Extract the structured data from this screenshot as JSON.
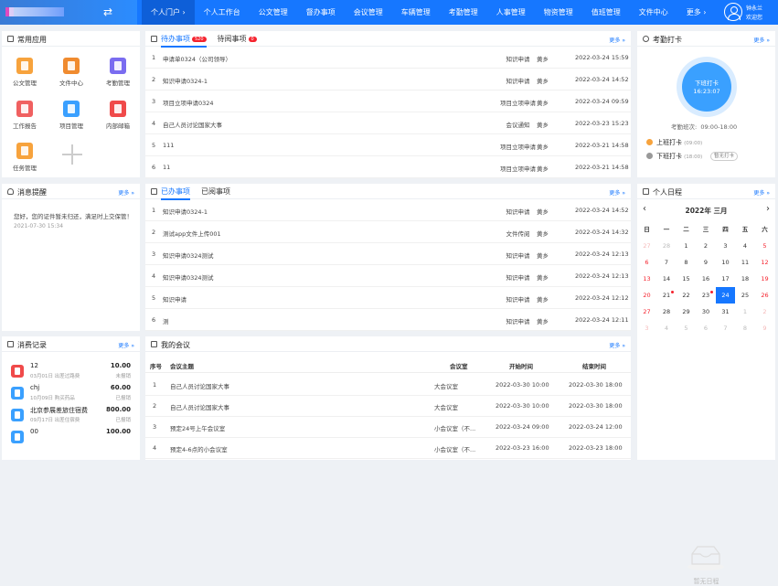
{
  "header": {
    "nav": [
      "个人门户 ›",
      "个人工作台",
      "公文管理",
      "督办事项",
      "会议管理",
      "车辆管理",
      "考勤管理",
      "人事管理",
      "物资管理",
      "值班管理",
      "文件中心",
      "更多 ›"
    ],
    "user_name": "钟永兰",
    "user_sub": "欢迎您"
  },
  "common_apps": {
    "title": "常用应用",
    "items": [
      {
        "label": "公文管理",
        "color": "#f7a33d"
      },
      {
        "label": "文件中心",
        "color": "#f08b2f"
      },
      {
        "label": "考勤管理",
        "color": "#7a6cf0"
      },
      {
        "label": "工作报告",
        "color": "#f06060"
      },
      {
        "label": "项目管理",
        "color": "#3aa0ff"
      },
      {
        "label": "内部邮箱",
        "color": "#f04a4a"
      },
      {
        "label": "任务管理",
        "color": "#f7a33d"
      }
    ]
  },
  "todo": {
    "tab1": "待办事项",
    "tab1_badge": "520",
    "tab2": "待阅事项",
    "tab2_badge": "0",
    "more": "更多",
    "rows": [
      {
        "no": "1",
        "title": "申请单0324（公司领导）",
        "type": "知识申请",
        "user": "黄乡",
        "time": "2022-03-24 15:59"
      },
      {
        "no": "2",
        "title": "知识申请0324-1",
        "type": "知识申请",
        "user": "黄乡",
        "time": "2022-03-24 14:52"
      },
      {
        "no": "3",
        "title": "项目立项申请0324",
        "type": "项目立项申请",
        "user": "黄乡",
        "time": "2022-03-24 09:59"
      },
      {
        "no": "4",
        "title": "自己人员讨论国家大事",
        "type": "会议通知",
        "user": "黄乡",
        "time": "2022-03-23 15:23"
      },
      {
        "no": "5",
        "title": "111",
        "type": "项目立项申请",
        "user": "黄乡",
        "time": "2022-03-21 14:58"
      },
      {
        "no": "6",
        "title": "11",
        "type": "项目立项申请",
        "user": "黄乡",
        "time": "2022-03-21 14:58"
      }
    ]
  },
  "attendance": {
    "title": "考勤打卡",
    "more": "更多",
    "clock_label": "下班打卡",
    "clock_time": "16:23:07",
    "shift_label": "考勤班次:",
    "shift": "09:00-18:00",
    "on_label": "上班打卡",
    "on_time": "(09:00)",
    "off_label": "下班打卡",
    "off_time": "(18:00)",
    "off_chip": "暂无打卡"
  },
  "notice": {
    "title": "消息提醒",
    "more": "更多",
    "text": "您好，您的证件暂未归还，满足时上交保管！",
    "time": "2021-07-30 15:34"
  },
  "done": {
    "tab1": "已办事项",
    "tab2": "已阅事项",
    "more": "更多",
    "rows": [
      {
        "no": "1",
        "title": "知识申请0324-1",
        "type": "知识申请",
        "user": "黄乡",
        "time": "2022-03-24 14:52"
      },
      {
        "no": "2",
        "title": "测试app文件上传001",
        "type": "文件传阅",
        "user": "黄乡",
        "time": "2022-03-24 14:32"
      },
      {
        "no": "3",
        "title": "知识申请0324测试",
        "type": "知识申请",
        "user": "黄乡",
        "time": "2022-03-24 12:13"
      },
      {
        "no": "4",
        "title": "知识申请0324测试",
        "type": "知识申请",
        "user": "黄乡",
        "time": "2022-03-24 12:13"
      },
      {
        "no": "5",
        "title": "知识申请",
        "type": "知识申请",
        "user": "黄乡",
        "time": "2022-03-24 12:12"
      },
      {
        "no": "6",
        "title": "测",
        "type": "知识申请",
        "user": "黄乡",
        "time": "2022-03-24 12:11"
      }
    ]
  },
  "schedule": {
    "title": "个人日程",
    "more": "更多",
    "month": "2022年 三月",
    "weekdays": [
      "日",
      "一",
      "二",
      "三",
      "四",
      "五",
      "六"
    ],
    "weeks": [
      [
        "27",
        "28",
        "1",
        "2",
        "3",
        "4",
        "5"
      ],
      [
        "6",
        "7",
        "8",
        "9",
        "10",
        "11",
        "12"
      ],
      [
        "13",
        "14",
        "15",
        "16",
        "17",
        "18",
        "19"
      ],
      [
        "20",
        "21",
        "22",
        "23",
        "24",
        "25",
        "26"
      ],
      [
        "27",
        "28",
        "29",
        "30",
        "31",
        "1",
        "2"
      ],
      [
        "3",
        "4",
        "5",
        "6",
        "7",
        "8",
        "9"
      ]
    ],
    "empty": "暂无日程"
  },
  "consume": {
    "title": "消费记录",
    "more": "更多",
    "rows": [
      {
        "name": "12",
        "sub": "03月01日  出差过路费",
        "amount": "10.00",
        "status": "未报销",
        "color": "#f04a4a"
      },
      {
        "name": "chj",
        "sub": "10月09日  购买药品",
        "amount": "60.00",
        "status": "已报销",
        "color": "#3aa0ff"
      },
      {
        "name": "北京参展差旅住宿费",
        "sub": "09月17日  出差住宿费",
        "amount": "800.00",
        "status": "已报销",
        "color": "#3aa0ff"
      },
      {
        "name": "00",
        "sub": "",
        "amount": "100.00",
        "status": "",
        "color": "#3aa0ff"
      }
    ]
  },
  "meetings": {
    "title": "我的会议",
    "more": "更多",
    "headers": [
      "序号",
      "会议主题",
      "会议室",
      "开始时间",
      "结束时间"
    ],
    "rows": [
      {
        "no": "1",
        "topic": "自己人员讨论国家大事",
        "room": "大会议室",
        "start": "2022-03-30 10:00",
        "end": "2022-03-30 18:00"
      },
      {
        "no": "2",
        "topic": "自己人员讨论国家大事",
        "room": "大会议室",
        "start": "2022-03-30 10:00",
        "end": "2022-03-30 18:00"
      },
      {
        "no": "3",
        "topic": "预定24号上午会议室",
        "room": "小会议室（不...",
        "start": "2022-03-24 09:00",
        "end": "2022-03-24 12:00"
      },
      {
        "no": "4",
        "topic": "预定4-6点的小会议室",
        "room": "小会议室（不...",
        "start": "2022-03-23 16:00",
        "end": "2022-03-23 18:00"
      }
    ]
  }
}
